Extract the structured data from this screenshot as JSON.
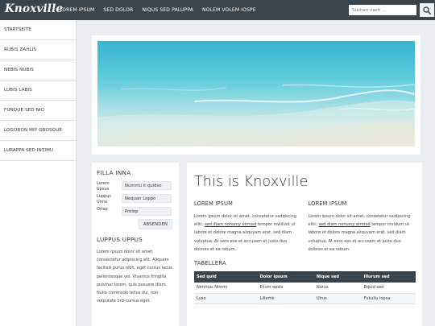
{
  "header": {
    "logo": "Knoxville",
    "nav": [
      "LOREM IPSUM",
      "SED DOLOR",
      "NIQUS SED PALUPPA",
      "NOLEM VOLEM IOSPE"
    ],
    "search_placeholder": "Suchen nach ...",
    "search_icon": "search-icon"
  },
  "sidebar": {
    "items": [
      "STARTSEITE",
      "RUBIS ZAHLIS",
      "NEBIS NUBIS",
      "LUBIS LABIS",
      "FUNQUE SED NIO",
      "LOGORON MIP GROSQUE",
      "LURAPPA SED INTIMU"
    ]
  },
  "filter": {
    "title": "FILLA INNA",
    "fields": [
      {
        "label": "Lorem Upsus",
        "value": "Nummu it quidse"
      },
      {
        "label": "Luppus Unna",
        "value": "Nequan Loppo"
      },
      {
        "label": "Orlep",
        "value": "Prolep"
      }
    ],
    "submit": "ABSENDEN",
    "section2_title": "LUPPUS UPPUS",
    "section2_text": "Lorem ipsum dolor sit amet, consectetur adipiscing elit. Aliquam facilisis purus nibh, eget cursus lacus pellentesque vel. Vivamus fringilla pulvinar lorem, quis posuere diam. Nulla commodo tellus dui, non vulputate orci cursus eget."
  },
  "main": {
    "title": "This is Knoxville",
    "col1": {
      "heading": "LOREM IPSUM",
      "text_a": "Lorem ipsum dolor sit amet, consetetur sadipscing elitr, ",
      "link": "sed diam nonumy eirmod",
      "text_b": " tempor invidunt ut labore et dolore magna aliquyam erat, sed diam voluptua. At vero eos et accusam et justo duo dolores et ea rebum."
    },
    "col2": {
      "heading": "LOREM IPSUM",
      "text_a": "Lorem ipsum dolor sit amet, consetetur sadipscing elitr, ",
      "link": "sed diam nonumy eirmod",
      "text_b": " tempor invidunt ut labore et dolore magna aliquyam erat, sed diam voluptua. At vero eos et accusam et justo duo dolores et ea rebum."
    },
    "table_title": "TABELLERA",
    "table": {
      "headers": [
        "Sed quid",
        "Dolor Ipsum",
        "Nique sed",
        "Illurum sed"
      ],
      "rows": [
        [
          "Nimmus Nimmi",
          "Ellum epsio",
          "Nurus",
          "Equid sed"
        ],
        [
          "Luso",
          "Lilleme",
          "Ulrus",
          "Fukullu lopsa"
        ]
      ]
    }
  },
  "colors": {
    "topbar": "#3a444c",
    "background": "#ebeef1",
    "panel": "#ffffff",
    "field": "#eef1f3"
  }
}
